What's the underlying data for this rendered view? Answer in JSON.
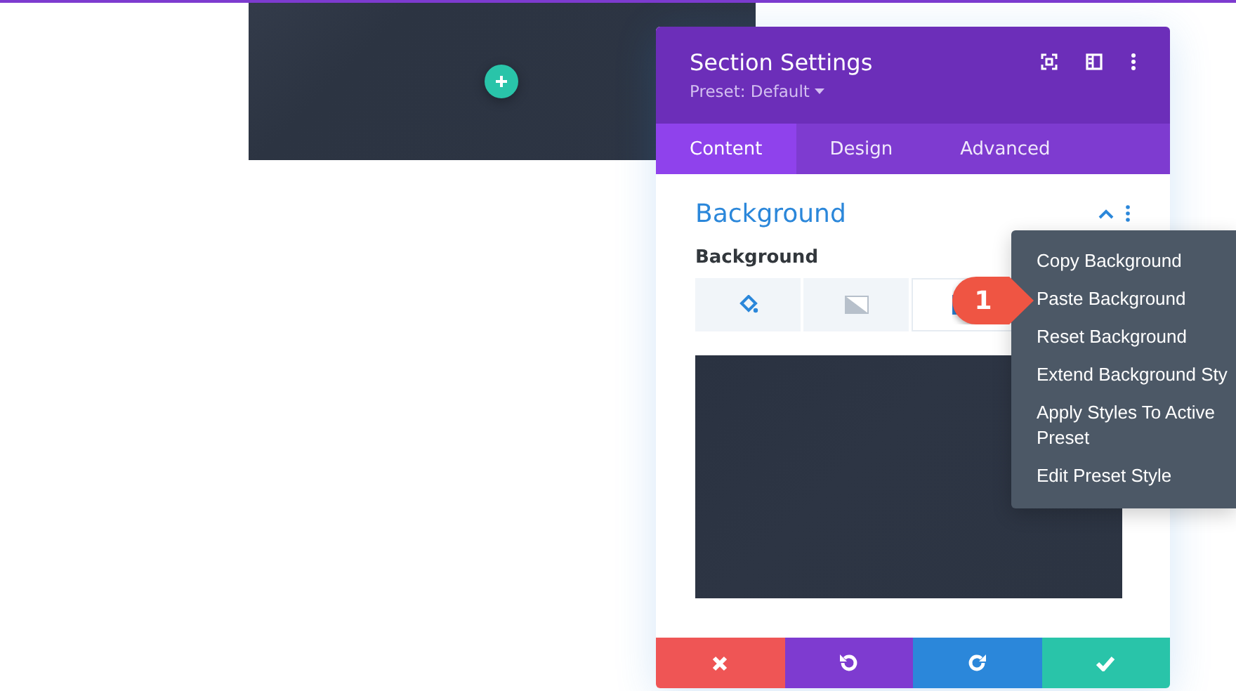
{
  "modal": {
    "title": "Section Settings",
    "preset": "Preset: Default",
    "tabs": [
      {
        "label": "Content",
        "selected": true
      },
      {
        "label": "Design",
        "selected": false
      },
      {
        "label": "Advanced",
        "selected": false
      }
    ],
    "group": {
      "title": "Background",
      "expanded": true,
      "field_label": "Background",
      "options": [
        {
          "kind": "color",
          "selected": false
        },
        {
          "kind": "gradient",
          "selected": false
        },
        {
          "kind": "image",
          "selected": true
        }
      ]
    },
    "footer": [
      {
        "kind": "cancel"
      },
      {
        "kind": "undo"
      },
      {
        "kind": "redo"
      },
      {
        "kind": "save"
      }
    ]
  },
  "menu": {
    "items": [
      "Copy Background",
      "Paste Background",
      "Reset Background",
      "Extend Background Sty",
      "Apply Styles To Active Preset",
      "Edit Preset Style"
    ]
  },
  "callout": {
    "label": "1"
  }
}
